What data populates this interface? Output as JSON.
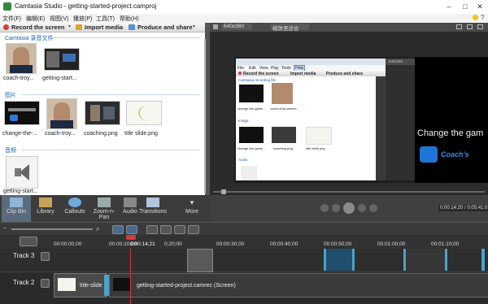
{
  "window": {
    "title": "Camtasia Studio - getting-started-project.camproj"
  },
  "menu": [
    "文件(F)",
    "编辑(E)",
    "视图(V)",
    "播放(P)",
    "工具(T)",
    "帮助(H)"
  ],
  "clip_bin": {
    "toolbar": {
      "record": "Record the screen",
      "import": "Import media",
      "produce": "Produce and share"
    },
    "sections": [
      {
        "label": "Camtasia 录音文件",
        "items": [
          "coach-troy...",
          "getting-start..."
        ]
      },
      {
        "label": "图片",
        "items": [
          "change-the-...",
          "coach-troy...",
          "coaching.png",
          "title slide.png"
        ]
      },
      {
        "label": "音频",
        "items": [
          "getting-start..."
        ]
      }
    ]
  },
  "preview": {
    "size_label": "640x360",
    "zoom_label": "缩放至适合",
    "inner": {
      "menu": [
        "File",
        "Edit",
        "View",
        "Play",
        "Tools",
        "Help"
      ],
      "toolbar": {
        "record": "Record the screen",
        "import": "Import media",
        "produce": "Produce and share"
      },
      "size_label": "640x360",
      "shrink_label": "Shrink to fit",
      "section1": "Camtasia recording file",
      "section1_items": [
        "change-the-game...",
        "coach-troy.camrec"
      ],
      "section2": "Image",
      "section2_items": [
        "change-the-game...",
        "coaching.png",
        "title-slide.png"
      ],
      "section3": "Audio"
    },
    "overlay_text": "Change the gam",
    "logo_text": "Coach's"
  },
  "tabs": [
    "Clip Bin",
    "Library",
    "Callouts",
    "Zoom-n-Pan",
    "Audio",
    "Transitions",
    "More"
  ],
  "player": {
    "time": "0:00:14:20 / 0:05:41:03"
  },
  "timeline": {
    "ruler": [
      "00:00:00;00",
      "00:00:10;00",
      "0:00:14;21",
      "0;20;00",
      "00:00:30;00",
      "00:00:40;00",
      "00:00:50;00",
      "00:01:00;00",
      "00:01:10;00"
    ],
    "tracks": [
      {
        "name": "Track 3"
      },
      {
        "name": "Track 2",
        "clips": [
          "title-slide",
          "getting-started-project.camrec (Screen)"
        ]
      }
    ]
  },
  "colors": {
    "accent": "#1a5fb4",
    "playhead": "#d23c3c",
    "clip": "#4aa3c9"
  }
}
